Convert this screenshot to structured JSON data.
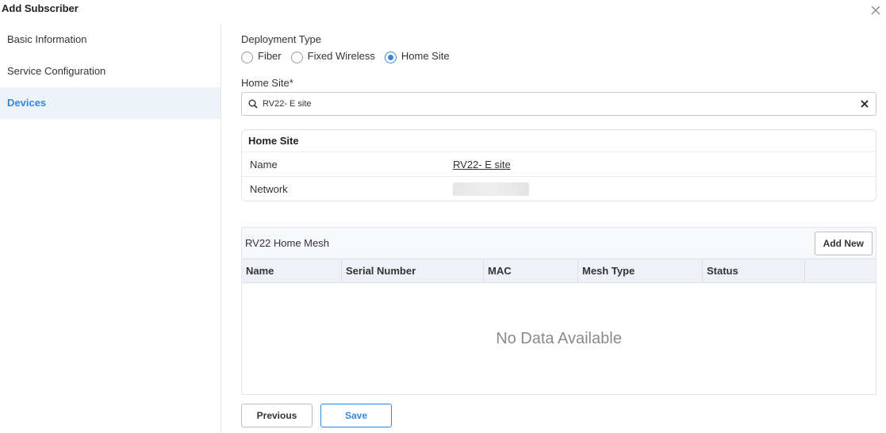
{
  "dialog": {
    "title": "Add Subscriber"
  },
  "sidebar": {
    "items": [
      {
        "label": "Basic Information"
      },
      {
        "label": "Service Configuration"
      },
      {
        "label": "Devices"
      }
    ]
  },
  "deployment": {
    "label": "Deployment Type",
    "options": [
      {
        "label": "Fiber",
        "selected": false
      },
      {
        "label": "Fixed Wireless",
        "selected": false
      },
      {
        "label": "Home Site",
        "selected": true
      }
    ]
  },
  "home_site_field": {
    "label": "Home Site*",
    "value": "RV22- E site"
  },
  "home_site_card": {
    "title": "Home Site",
    "rows": [
      {
        "key": "Name",
        "value": "RV22- E site"
      },
      {
        "key": "Network",
        "value": ""
      }
    ]
  },
  "mesh": {
    "title": "RV22 Home Mesh",
    "add_label": "Add New",
    "columns": [
      "Name",
      "Serial Number",
      "MAC",
      "Mesh Type",
      "Status",
      ""
    ],
    "empty_text": "No Data Available"
  },
  "footer": {
    "previous_label": "Previous",
    "save_label": "Save"
  },
  "colors": {
    "accent": "#3a86d6",
    "active_bg": "#eef3fa"
  }
}
